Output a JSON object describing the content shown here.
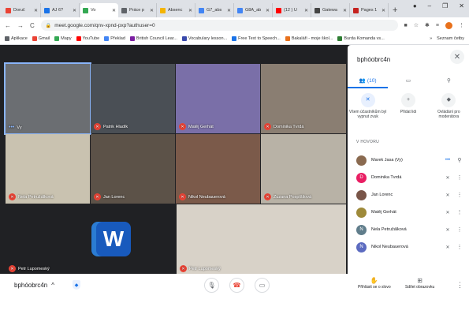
{
  "tabs": [
    {
      "label": "Doruč",
      "color": "#ea4335"
    },
    {
      "label": "AJ 6?",
      "color": "#1a73e8"
    },
    {
      "label": "Vo",
      "color": "#34a853",
      "active": true
    },
    {
      "label": "Práce p",
      "color": "#5f6368"
    },
    {
      "label": "Absenc",
      "color": "#f4b400"
    },
    {
      "label": "G7_abs",
      "color": "#4285f4"
    },
    {
      "label": "G8A_ab",
      "color": "#4285f4"
    },
    {
      "label": "(12 ) U",
      "color": "#ff0000"
    },
    {
      "label": "Gatewa",
      "color": "#444444"
    },
    {
      "label": "Pages 1",
      "color": "#c5221f"
    }
  ],
  "address": {
    "url": "meet.google.com/qnv-xpnd-pxp?authuser=0"
  },
  "bookmarks": [
    {
      "label": "Aplikace",
      "color": "#5f6368"
    },
    {
      "label": "Gmail",
      "color": "#ea4335"
    },
    {
      "label": "Mapy",
      "color": "#34a853"
    },
    {
      "label": "YouTube",
      "color": "#ff0000"
    },
    {
      "label": "Překlad",
      "color": "#4285f4"
    },
    {
      "label": "British Council Lear...",
      "color": "#7b1fa2"
    },
    {
      "label": "Vocabulary lesson...",
      "color": "#3949ab"
    },
    {
      "label": "Free Text to Speech...",
      "color": "#1a73e8"
    },
    {
      "label": "Bakaláři - moje škol...",
      "color": "#e8711c"
    },
    {
      "label": "Burda Komanda vs...",
      "color": "#2e7d32"
    }
  ],
  "bookmarks_right": [
    "»",
    "Seznam četby"
  ],
  "tiles": [
    {
      "name": "Vy",
      "speaking": true,
      "bg": "#6b6e72"
    },
    {
      "name": "Patrik Hladík",
      "bg": "#4a4f55"
    },
    {
      "name": "Matěj Gerhát",
      "bg": "#7a6fa8"
    },
    {
      "name": "Dominika Tvrdá",
      "bg": "#8a7e72"
    },
    {
      "name": "Nela Petružálková",
      "bg": "#c9c2b0"
    },
    {
      "name": "Jan Lorenc",
      "bg": "#5c5248"
    },
    {
      "name": "Nikol Neubauerová",
      "bg": "#7b5a4a"
    },
    {
      "name": "Zuzana Pospíšilová",
      "bg": "#b8b2a6"
    },
    {
      "name": "Petr Lupomeský",
      "bg": "#202124"
    },
    {
      "name": "Petr Lupomeský",
      "bg": "#d8d2c8"
    }
  ],
  "panel": {
    "title": "bphóobrc4n",
    "tab_people": "(10)",
    "actions": [
      {
        "label": "Všem účastníkům byl vypnut zvuk",
        "icon": "mic-off"
      },
      {
        "label": "Přidat lidi",
        "icon": "add-person"
      },
      {
        "label": "Ovládání pro moderátora",
        "icon": "shield"
      }
    ],
    "section": "V HOVORU",
    "participants": [
      {
        "name": "Marek Jasa (Vy)",
        "initial": "",
        "color": "#8a6a50",
        "status": "speaking"
      },
      {
        "name": "Dominika Tvrdá",
        "initial": "D",
        "color": "#e91e63",
        "status": "muted"
      },
      {
        "name": "Jan Lorenc",
        "initial": "",
        "color": "#795548",
        "status": "muted"
      },
      {
        "name": "Matěj Gerhát",
        "initial": "",
        "color": "#9e8a3a",
        "status": "muted"
      },
      {
        "name": "Nela Petružálková",
        "initial": "N",
        "color": "#607d8b",
        "status": "muted"
      },
      {
        "name": "Nikol Neubauerová",
        "initial": "N",
        "color": "#5c6bc0",
        "status": "muted"
      }
    ]
  },
  "bottom": {
    "meeting_code": "bphóobrc4n",
    "raise_hand": "Přihlásit se o slovo",
    "present": "Sdílet obrazovku"
  }
}
